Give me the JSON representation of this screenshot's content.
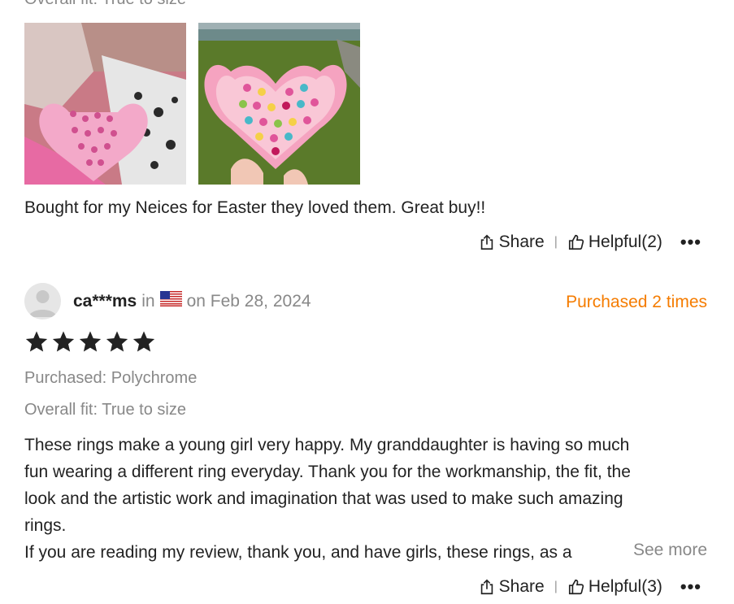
{
  "review1": {
    "fit_label": "Overall fit: True to size",
    "text": "Bought for my Neices for Easter they loved them. Great buy!!",
    "share_label": "Share",
    "helpful_label": "Helpful(2)"
  },
  "review2": {
    "username": "ca***ms",
    "in_label": "in",
    "date": "on Feb 28, 2024",
    "purchased_times": "Purchased 2 times",
    "rating": 5,
    "purchased": "Purchased: Polychrome",
    "fit": "Overall fit: True to size",
    "text_lines": [
      "These rings make a young girl very happy. My granddaughter is having so much",
      "fun wearing a different ring everyday. Thank you for the workmanship, the fit, the",
      "look and the artistic work and imagination that was used to make such amazing",
      "rings.",
      "If you are reading my review, thank you, and have girls, these rings, as a"
    ],
    "see_more": "See more",
    "share_label": "Share",
    "helpful_label": "Helpful(3)"
  },
  "more_icon": "•••",
  "colors": {
    "accent": "#f57c00",
    "muted": "#888888",
    "text": "#222222"
  }
}
